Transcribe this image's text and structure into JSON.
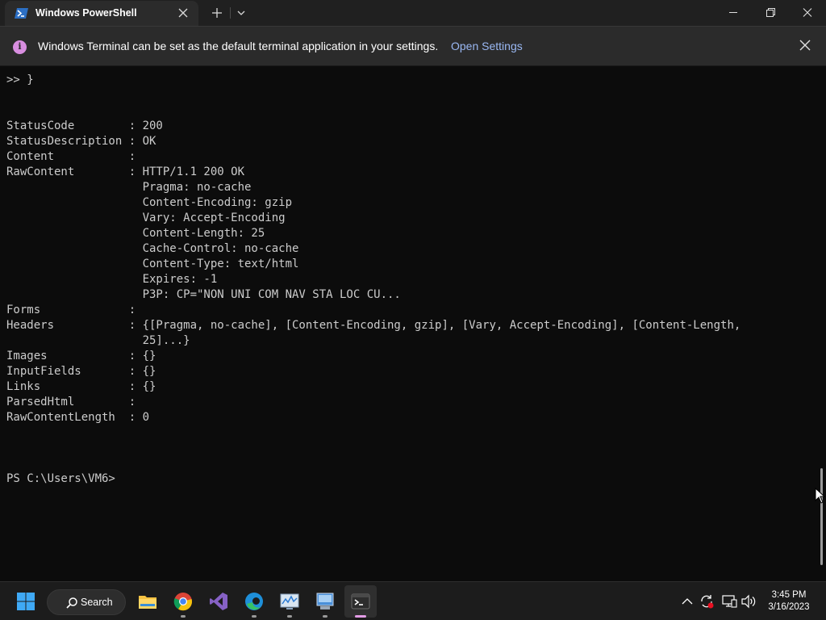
{
  "titlebar": {
    "tab_title": "Windows PowerShell"
  },
  "infobar": {
    "message": "Windows Terminal can be set as the default terminal application in your settings.",
    "link": "Open Settings"
  },
  "terminal": {
    "lines": [
      ">> }",
      "",
      "",
      "StatusCode        : 200",
      "StatusDescription : OK",
      "Content           :",
      "RawContent        : HTTP/1.1 200 OK",
      "                    Pragma: no-cache",
      "                    Content-Encoding: gzip",
      "                    Vary: Accept-Encoding",
      "                    Content-Length: 25",
      "                    Cache-Control: no-cache",
      "                    Content-Type: text/html",
      "                    Expires: -1",
      "                    P3P: CP=\"NON UNI COM NAV STA LOC CU...",
      "Forms             :",
      "Headers           : {[Pragma, no-cache], [Content-Encoding, gzip], [Vary, Accept-Encoding], [Content-Length,",
      "                    25]...}",
      "Images            : {}",
      "InputFields       : {}",
      "Links             : {}",
      "ParsedHtml        :",
      "RawContentLength  : 0",
      "",
      "",
      "",
      "PS C:\\Users\\VM6>"
    ]
  },
  "taskbar": {
    "search_label": "Search",
    "time": "3:45 PM",
    "date": "3/16/2023"
  },
  "colors": {
    "terminal_bg": "#0c0c0c",
    "terminal_text": "#cccccc",
    "link": "#9ab8f3",
    "info_icon": "#d88ee0",
    "active_indicator": "#e39ce6"
  }
}
